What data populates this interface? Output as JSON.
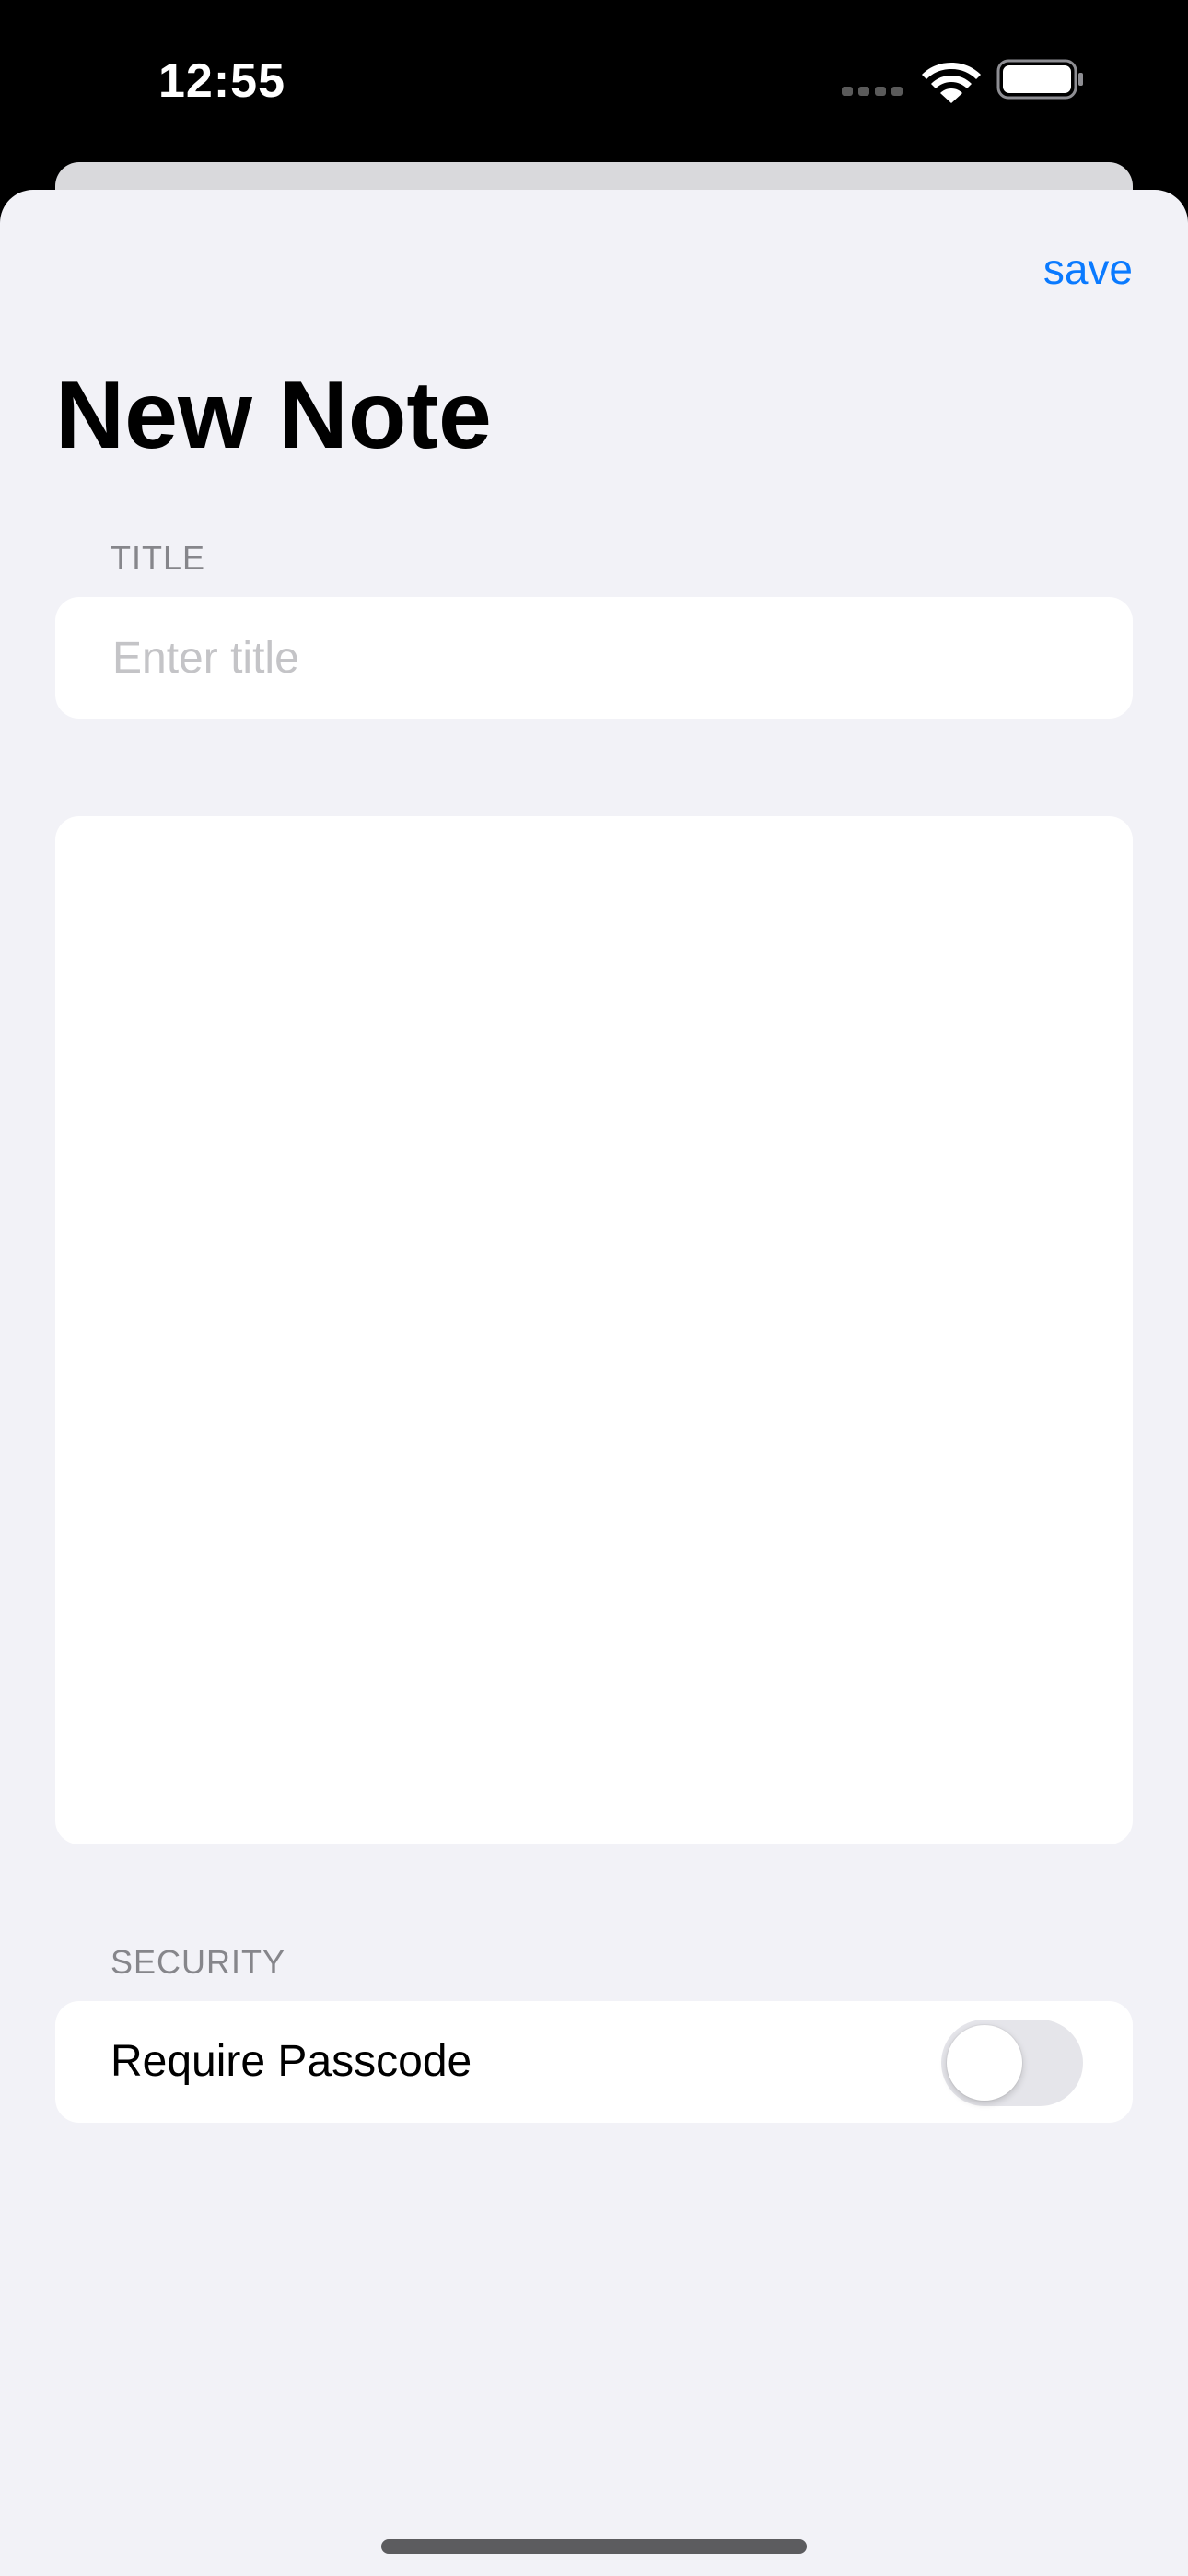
{
  "status_bar": {
    "time": "12:55",
    "wifi_icon": "wifi-icon",
    "battery_icon": "battery-icon",
    "signal_icon": "cellular-signal-icon"
  },
  "nav": {
    "save_label": "save"
  },
  "page": {
    "title": "New Note"
  },
  "form": {
    "title_section": {
      "header": "TITLE",
      "value": "",
      "placeholder": "Enter title"
    },
    "body": {
      "value": ""
    },
    "security_section": {
      "header": "SECURITY",
      "passcode_label": "Require Passcode",
      "passcode_enabled": false
    }
  },
  "colors": {
    "accent": "#0a7aff",
    "background": "#f2f2f7",
    "card": "#ffffff",
    "section_header": "#86868b",
    "placeholder": "#c4c4c7",
    "toggle_off": "#e5e5ea"
  }
}
